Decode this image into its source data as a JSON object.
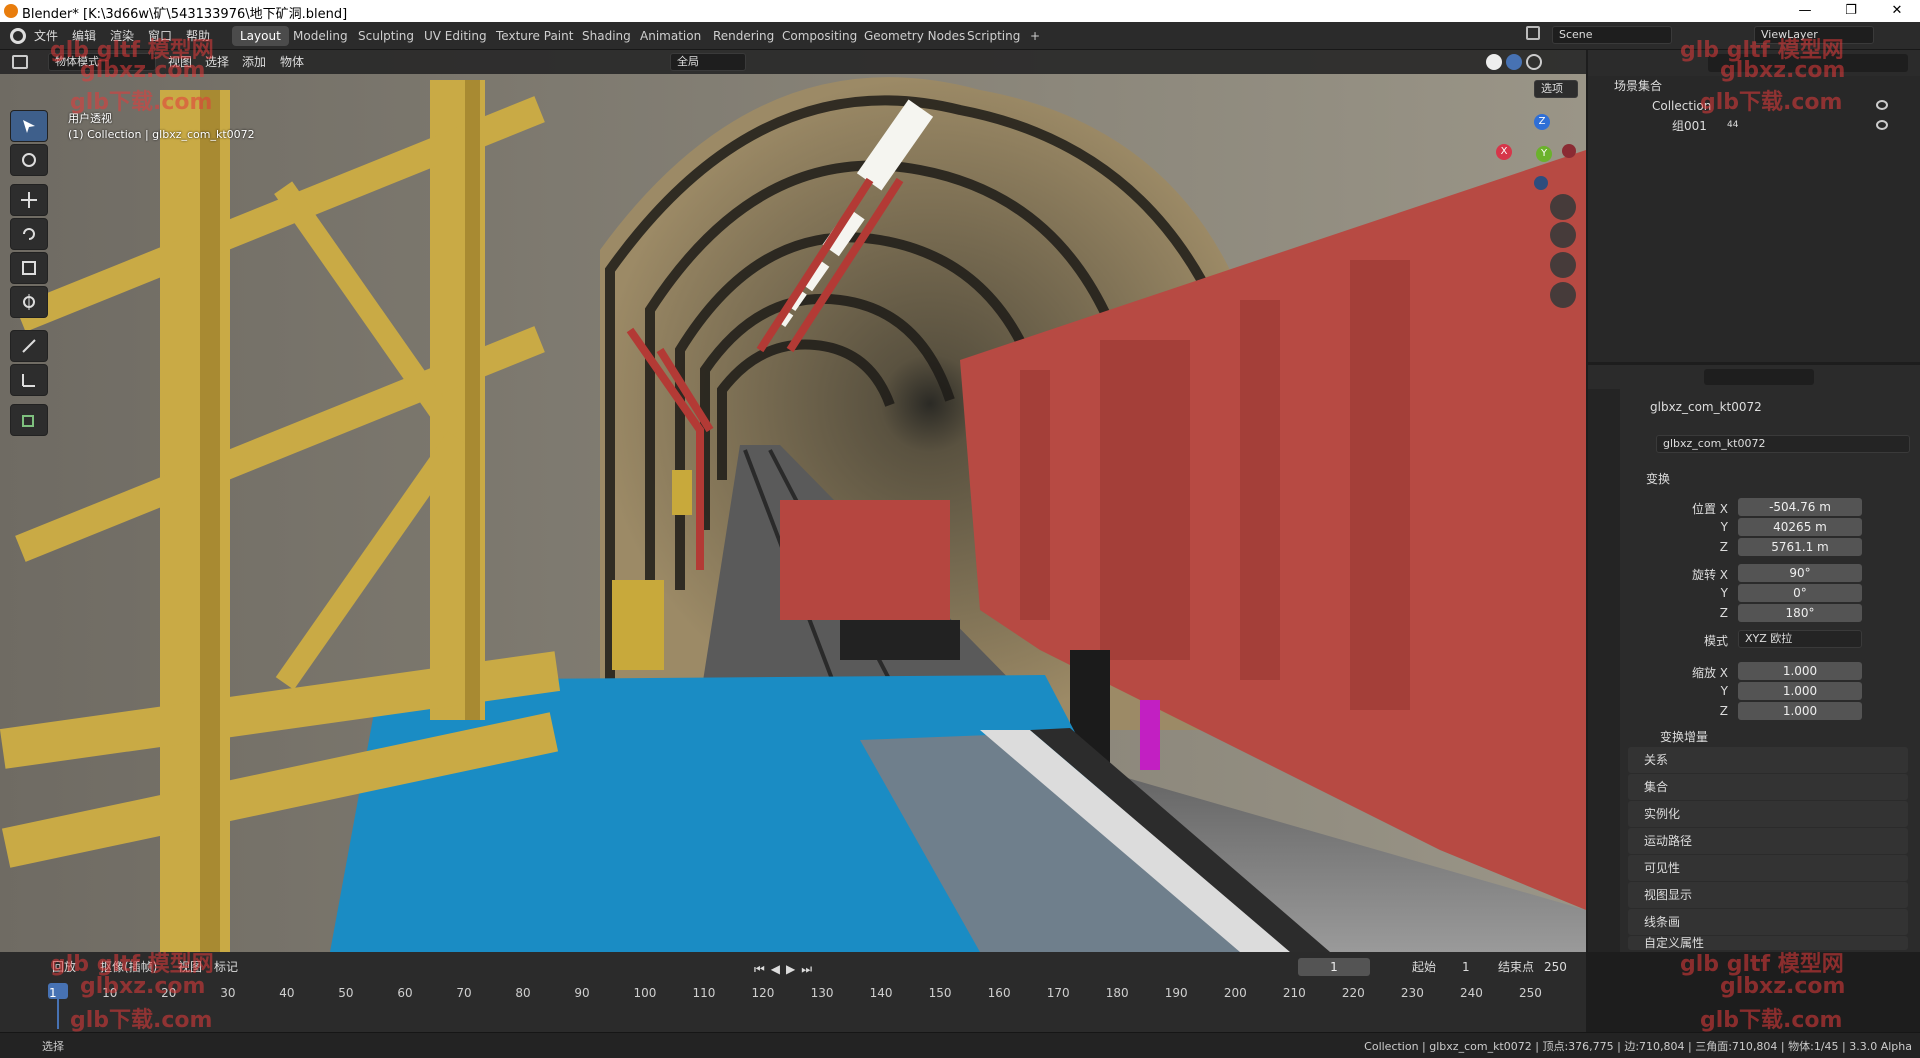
{
  "window": {
    "title": "Blender* [K:\\3d66w\\矿\\543133976\\地下矿洞.blend]",
    "minimize": "—",
    "maximize": "❐",
    "close": "✕"
  },
  "menubar": {
    "items": [
      "文件",
      "编辑",
      "渲染",
      "窗口",
      "帮助"
    ]
  },
  "workspaces": [
    "Layout",
    "Modeling",
    "Sculpting",
    "UV Editing",
    "Texture Paint",
    "Shading",
    "Animation",
    "Rendering",
    "Compositing",
    "Geometry Nodes",
    "Scripting"
  ],
  "workspace_add": "+",
  "scene": {
    "label": "Scene",
    "viewlayer": "ViewLayer"
  },
  "viewport_header": {
    "mode": "物体模式",
    "menus": [
      "视图",
      "选择",
      "添加",
      "物体"
    ],
    "orientation": "全局",
    "options": "选项"
  },
  "viewport": {
    "view_name": "用户透视",
    "collection_label": "(1) Collection | glbxz_com_kt0072",
    "gizmo": {
      "x": "X",
      "y": "Y",
      "z": "Z"
    }
  },
  "outliner": {
    "root": "场景集合",
    "collection": "Collection",
    "child": "组001",
    "child_count": "44"
  },
  "properties": {
    "object_name": "glbxz_com_kt0072",
    "data_name": "glbxz_com_kt0072",
    "transform_title": "变换",
    "location_label": "位置 X",
    "location": [
      "-504.76 m",
      "40265 m",
      "5761.1 m"
    ],
    "rotation_label": "旋转 X",
    "rotation": [
      "90°",
      "0°",
      "180°"
    ],
    "mode_label": "模式",
    "mode_value": "XYZ 欧拉",
    "scale_label": "缩放 X",
    "scale": [
      "1.000",
      "1.000",
      "1.000"
    ],
    "axis_y": "Y",
    "axis_z": "Z",
    "delta": "变换增量",
    "sections": [
      "关系",
      "集合",
      "实例化",
      "运动路径",
      "可见性",
      "视图显示",
      "线条画",
      "自定义属性"
    ]
  },
  "timeline": {
    "menus": [
      "回放",
      "抠像(插帧)",
      "视图",
      "标记"
    ],
    "current_frame": "1",
    "start_label": "起始",
    "start": "1",
    "end_label": "结束点",
    "end": "250",
    "ticks": [
      "1",
      "10",
      "20",
      "30",
      "40",
      "50",
      "60",
      "70",
      "80",
      "90",
      "100",
      "110",
      "120",
      "130",
      "140",
      "150",
      "160",
      "170",
      "180",
      "190",
      "200",
      "210",
      "220",
      "230",
      "240",
      "250"
    ]
  },
  "statusbar": {
    "left": "选择",
    "right": "Collection | glbxz_com_kt0072 | 顶点:376,775 | 边:710,804 | 三角面:710,804 | 物体:1/45 | 3.3.0 Alpha"
  },
  "watermarks": [
    "glb gltf 模型网",
    "glbxz.com",
    "glb下载.com"
  ],
  "colors": {
    "accent": "#4772b3",
    "blender_orange": "#e87d0d",
    "tunnel_rock": "#8a7d63",
    "wagon_red": "#b84a44",
    "floor_blue": "#1a8cc4",
    "scaffold_yellow": "#c9aa45"
  }
}
